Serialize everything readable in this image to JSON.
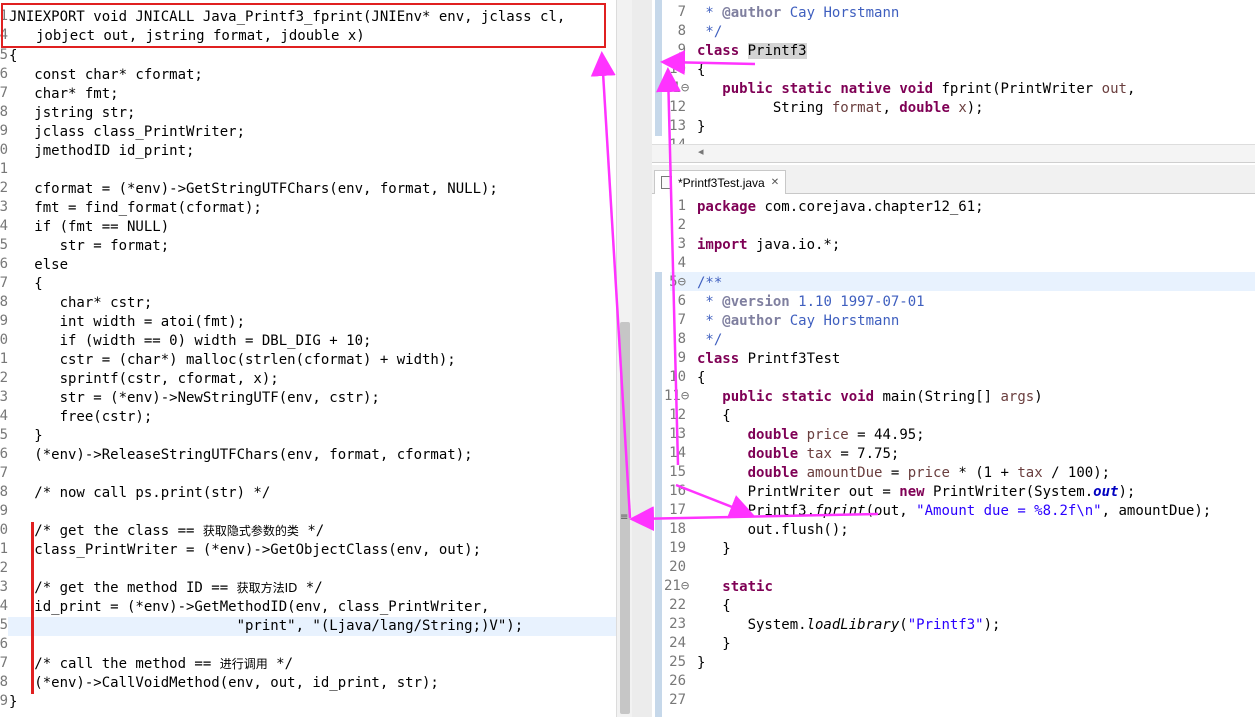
{
  "left_editor": {
    "signature_1": "JNIEXPORT void JNICALL Java_Printf3_fprint(JNIEnv* env, jclass cl,",
    "signature_2": "jobject out, jstring format, jdouble x)",
    "gutter_digits": [
      "1",
      "4",
      "5",
      "6",
      "7",
      "8",
      "9",
      "0",
      "1",
      "2",
      "3",
      "4",
      "5",
      "6",
      "7",
      "8",
      "9",
      "0",
      "1",
      "2",
      "3",
      "4",
      "5",
      "6",
      "7",
      "8",
      "9",
      "0",
      "1",
      "2",
      "3",
      "4",
      "5",
      "6",
      "7",
      "8",
      "9",
      "0",
      "1",
      "2",
      "3",
      "4",
      "5",
      "6",
      "7",
      "8",
      "9",
      "0",
      "1"
    ],
    "lines": [
      "{",
      "   const char* cformat;",
      "   char* fmt;",
      "   jstring str;",
      "   jclass class_PrintWriter;",
      "   jmethodID id_print;",
      "",
      "   cformat = (*env)->GetStringUTFChars(env, format, NULL);",
      "   fmt = find_format(cformat);",
      "   if (fmt == NULL)",
      "      str = format;",
      "   else",
      "   {",
      "      char* cstr;",
      "      int width = atoi(fmt);",
      "      if (width == 0) width = DBL_DIG + 10;",
      "      cstr = (char*) malloc(strlen(cformat) + width);",
      "      sprintf(cstr, cformat, x);",
      "      str = (*env)->NewStringUTF(env, cstr);",
      "      free(cstr);",
      "   }",
      "   (*env)->ReleaseStringUTFChars(env, format, cformat);",
      "",
      "   /* now call ps.print(str) */",
      "",
      "   /* get the class == ",
      "   class_PrintWriter = (*env)->GetObjectClass(env, out);",
      "",
      "   /* get the method ID == ",
      "   id_print = (*env)->GetMethodID(env, class_PrintWriter,",
      "                           \"print\", \"(Ljava/lang/String;)V\");",
      "",
      "   /* call the method == ",
      "   (*env)->CallVoidMethod(env, out, id_print, str);",
      "}"
    ],
    "cjk_comments": {
      "get_class": "获取隐式参数的类",
      "get_method": "获取方法ID",
      "call_method": "进行调用",
      "close": " */"
    }
  },
  "top_right_editor": {
    "line_numbers": [
      "7",
      "8",
      "9",
      "10",
      "11",
      "12",
      "13",
      "14"
    ],
    "lines": [
      " * @author Cay Horstmann",
      " */",
      "class Printf3",
      "{",
      "   public static native void fprint(PrintWriter out,",
      "         String format, double x);",
      "}"
    ],
    "scroll_left_arrow": "◂"
  },
  "bottom_right_editor": {
    "tab_label": "*Printf3Test.java",
    "tab_close": "✕",
    "line_numbers": [
      "1",
      "2",
      "3",
      "4",
      "5",
      "6",
      "7",
      "8",
      "9",
      "10",
      "11",
      "12",
      "13",
      "14",
      "15",
      "16",
      "17",
      "18",
      "19",
      "20",
      "21",
      "22",
      "23",
      "24",
      "25",
      "26",
      "27"
    ],
    "lines": [
      "package com.corejava.chapter12_61;",
      "",
      "import java.io.*;",
      "",
      "/**",
      " * @version 1.10 1997-07-01",
      " * @author Cay Horstmann",
      " */",
      "class Printf3Test",
      "{",
      "   public static void main(String[] args)",
      "   {",
      "      double price = 44.95;",
      "      double tax = 7.75;",
      "      double amountDue = price * (1 + tax / 100);",
      "      PrintWriter out = new PrintWriter(System.out);",
      "      Printf3.fprint(out, \"Amount due = %8.2f\\n\", amountDue);",
      "      out.flush();",
      "   }",
      "",
      "   static",
      "   {",
      "      System.loadLibrary(\"Printf3\");",
      "   }",
      "}",
      "",
      ""
    ]
  },
  "colors": {
    "keyword": "#7f0055",
    "string": "#2a00ff",
    "javadoc": "#3f5fbf",
    "annotation_arrow": "#ff33ff",
    "red_box": "#e02020",
    "current_line": "#e8f2fe"
  }
}
